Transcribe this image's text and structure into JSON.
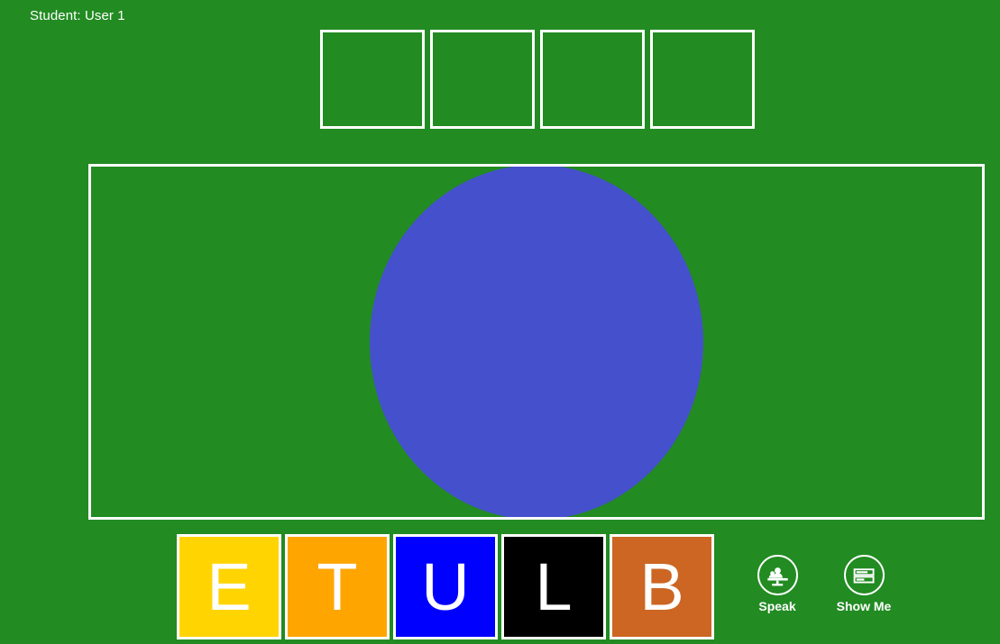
{
  "app": {
    "background_color": "#228B22",
    "outline_color": "#ffffff"
  },
  "header": {
    "student_label": "Student: User 1"
  },
  "answer_area": {
    "slot_count": 4,
    "slots": [
      {
        "value": "",
        "index": 1
      },
      {
        "value": "",
        "index": 2
      },
      {
        "value": "",
        "index": 3
      },
      {
        "value": "",
        "index": 4
      }
    ]
  },
  "display_panel": {
    "shape": "circle",
    "shape_color": "#4550CC",
    "border_color": "#ffffff"
  },
  "tile_tray": {
    "tiles": [
      {
        "letter": "E",
        "bg": "#FFD400",
        "text": "#ffffff"
      },
      {
        "letter": "T",
        "bg": "#FFA500",
        "text": "#ffffff"
      },
      {
        "letter": "U",
        "bg": "#0000FF",
        "text": "#ffffff"
      },
      {
        "letter": "L",
        "bg": "#000000",
        "text": "#ffffff"
      },
      {
        "letter": "B",
        "bg": "#CC6622",
        "text": "#ffffff"
      }
    ]
  },
  "actions": [
    {
      "label": "Speak",
      "icon": "speaker-podium-icon"
    },
    {
      "label": "Show Me",
      "icon": "list-bars-icon"
    }
  ]
}
